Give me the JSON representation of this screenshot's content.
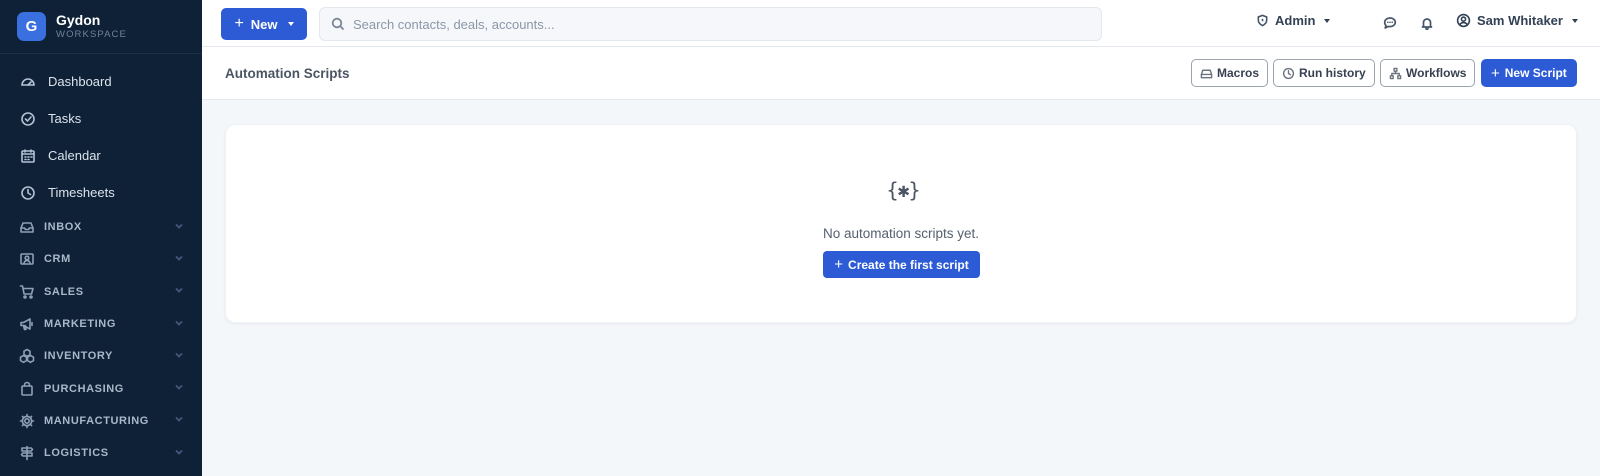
{
  "brand": {
    "logo_letter": "G",
    "name": "Gydon",
    "subtitle": "WORKSPACE"
  },
  "sidebar": {
    "items": [
      {
        "label": "Dashboard",
        "icon": "gauge-icon"
      },
      {
        "label": "Tasks",
        "icon": "check-circle-icon"
      },
      {
        "label": "Calendar",
        "icon": "calendar-icon"
      },
      {
        "label": "Timesheets",
        "icon": "clock-icon"
      }
    ],
    "groups": [
      {
        "label": "INBOX",
        "icon": "inbox-icon"
      },
      {
        "label": "CRM",
        "icon": "contact-card-icon"
      },
      {
        "label": "SALES",
        "icon": "cart-icon"
      },
      {
        "label": "MARKETING",
        "icon": "megaphone-icon"
      },
      {
        "label": "INVENTORY",
        "icon": "boxes-icon"
      },
      {
        "label": "PURCHASING",
        "icon": "bag-icon"
      },
      {
        "label": "MANUFACTURING",
        "icon": "cog-icon"
      },
      {
        "label": "LOGISTICS",
        "icon": "signpost-icon"
      }
    ]
  },
  "topbar": {
    "new_label": "New",
    "search_placeholder": "Search contacts, deals, accounts...",
    "admin_label": "Admin",
    "user_name": "Sam Whitaker"
  },
  "page": {
    "title": "Automation Scripts",
    "actions": {
      "macros": "Macros",
      "run_history": "Run history",
      "workflows": "Workflows",
      "new_script": "New Script"
    }
  },
  "empty_state": {
    "icon_glyph": "{✱}",
    "message": "No automation scripts yet.",
    "button_label": "Create the first script"
  },
  "colors": {
    "accent": "#2d5bd6",
    "sidebar_bg": "#0f2137",
    "page_bg": "#f4f7fa"
  }
}
